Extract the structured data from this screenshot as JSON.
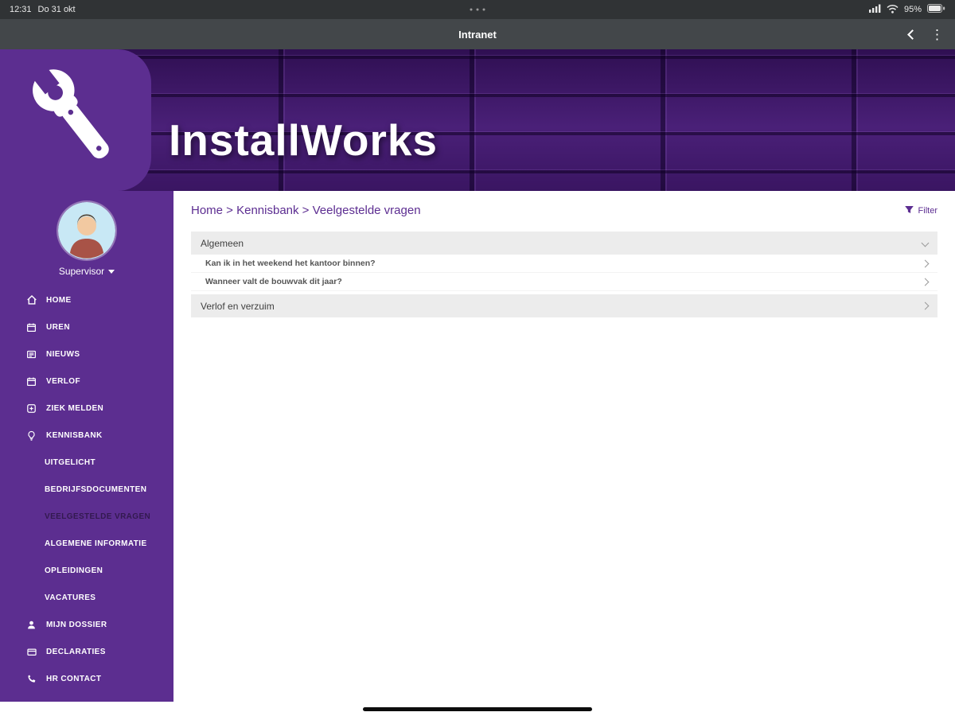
{
  "status_bar": {
    "time": "12:31",
    "date": "Do 31 okt",
    "battery": "95%"
  },
  "nav_bar": {
    "title": "Intranet"
  },
  "banner": {
    "app_name": "InstallWorks"
  },
  "sidebar": {
    "user": {
      "name": "Supervisor"
    },
    "items": [
      {
        "label": "HOME",
        "icon": "home"
      },
      {
        "label": "UREN",
        "icon": "calendar"
      },
      {
        "label": "NIEUWS",
        "icon": "news"
      },
      {
        "label": "VERLOF",
        "icon": "calendar"
      },
      {
        "label": "ZIEK MELDEN",
        "icon": "sick"
      },
      {
        "label": "KENNISBANK",
        "icon": "knowledge"
      },
      {
        "label": "UITGELICHT",
        "sub": true
      },
      {
        "label": "BEDRIJFSDOCUMENTEN",
        "sub": true
      },
      {
        "label": "VEELGESTELDE VRAGEN",
        "sub": true,
        "active": true
      },
      {
        "label": "ALGEMENE INFORMATIE",
        "sub": true
      },
      {
        "label": "OPLEIDINGEN",
        "sub": true
      },
      {
        "label": "VACATURES",
        "sub": true
      },
      {
        "label": "MIJN DOSSIER",
        "icon": "person"
      },
      {
        "label": "DECLARATIES",
        "icon": "card"
      },
      {
        "label": "HR CONTACT",
        "icon": "phone"
      }
    ]
  },
  "main": {
    "breadcrumb": "Home > Kennisbank > Veelgestelde vragen",
    "filter_label": "Filter",
    "faq": [
      {
        "type": "section",
        "label": "Algemeen",
        "expanded": true
      },
      {
        "type": "question",
        "label": "Kan ik in het weekend het kantoor binnen?"
      },
      {
        "type": "question",
        "label": "Wanneer valt de bouwvak dit jaar?"
      },
      {
        "type": "section",
        "label": "Verlof en verzuim",
        "expanded": false
      }
    ]
  },
  "colors": {
    "accent": "#5c2d91",
    "sidebar": "#5c2e90",
    "faq_header_bg": "#ececec"
  }
}
